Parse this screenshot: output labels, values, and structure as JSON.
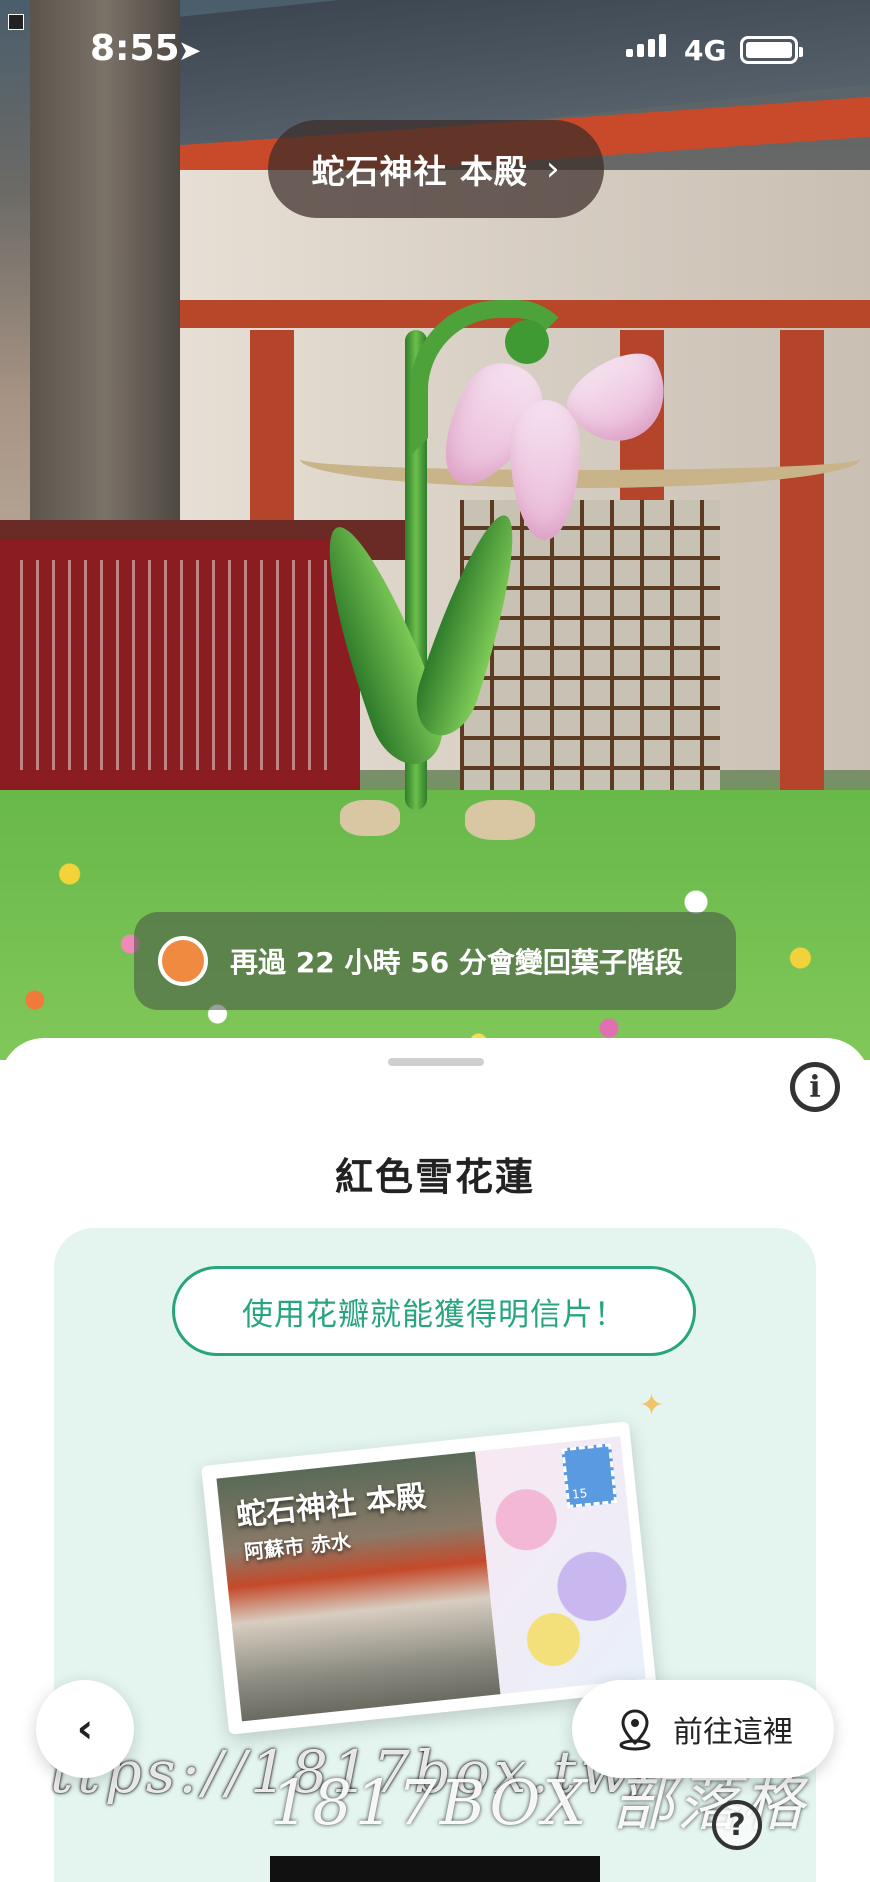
{
  "status_bar": {
    "time": "8:55",
    "network": "4G"
  },
  "location_pill": {
    "label": "蛇石神社 本殿",
    "chevron": "›"
  },
  "timer_banner": {
    "text": "再過 22 小時 56 分會變回葉子階段",
    "dot_color": "#f08a40"
  },
  "sheet": {
    "title": "紅色雪花蓮",
    "info_icon": "i",
    "cta_label": "使用花瓣就能獲得明信片！",
    "postcard": {
      "title": "蛇石神社 本殿",
      "subtitle": "阿蘇市 赤水",
      "stamp_value": "15"
    }
  },
  "controls": {
    "back_icon": "‹",
    "go_label": "前往這裡",
    "help_icon": "?"
  },
  "watermark": {
    "line1": "ttps://1817box.tw/",
    "line2": "1817BOX 部落格"
  },
  "colors": {
    "accent": "#27a57e",
    "card_bg": "#e4f5ef"
  }
}
